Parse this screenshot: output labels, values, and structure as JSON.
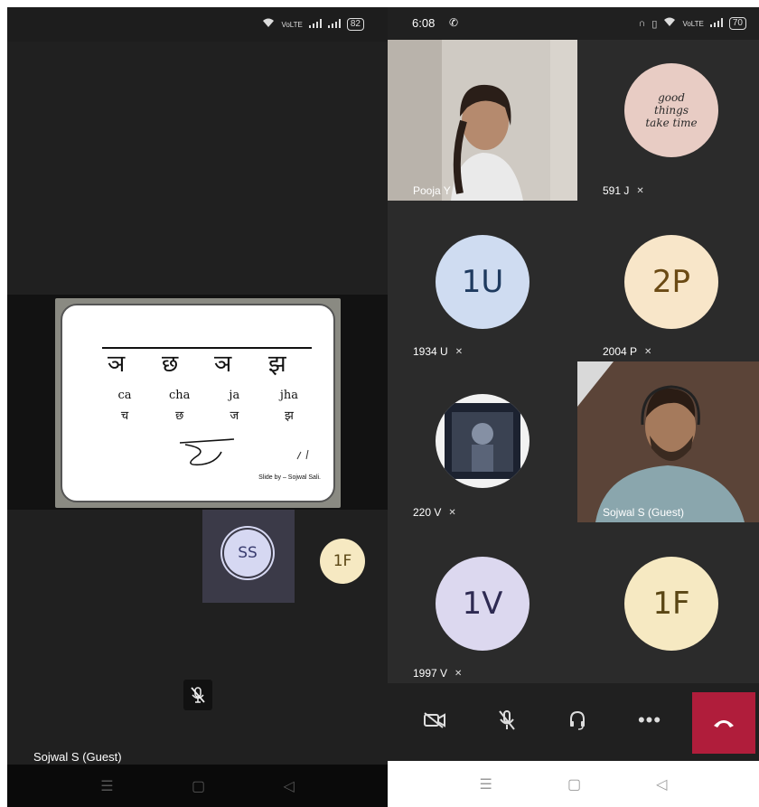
{
  "left_phone": {
    "status_battery": "82",
    "slide": {
      "handwritten_chars": [
        "ञ",
        "छ",
        "ञ",
        "झ"
      ],
      "latin": [
        "ca",
        "cha",
        "ja",
        "jha"
      ],
      "devanagari": [
        "च",
        "छ",
        "ज",
        "झ"
      ],
      "credit": "Slide by – Sojwal Sali."
    },
    "participants": [
      {
        "initials": "SS"
      },
      {
        "initials": "1F"
      }
    ],
    "presenter_name": "Sojwal S (Guest)",
    "nav": [
      "☰",
      "▢",
      "◁"
    ]
  },
  "right_phone": {
    "status_time": "6:08",
    "status_battery": "70",
    "tiles": [
      {
        "name": "Pooja Y",
        "type": "video"
      },
      {
        "name": "591 J",
        "type": "image",
        "muted": "🔇",
        "image_text": "good things take time"
      },
      {
        "name": "1934 U",
        "initials": "1U",
        "avatar_color": "#cfdcf1",
        "text_color": "#1e3a5f",
        "muted": "🔇"
      },
      {
        "name": "2004 P",
        "initials": "2P",
        "avatar_color": "#f8e6c9",
        "text_color": "#6b4a14",
        "muted": "🔇"
      },
      {
        "name": "220 V",
        "type": "image",
        "muted": "🔇"
      },
      {
        "name": "Sojwal S (Guest)",
        "type": "video"
      },
      {
        "name": "1997 V",
        "initials": "1V",
        "avatar_color": "#dcd8ef",
        "text_color": "#2e2a52",
        "muted": "🔇"
      },
      {
        "initials": "1F",
        "avatar_color": "#f6e9c2",
        "text_color": "#5a4614"
      }
    ],
    "nav": [
      "☰",
      "▢",
      "◁"
    ]
  }
}
